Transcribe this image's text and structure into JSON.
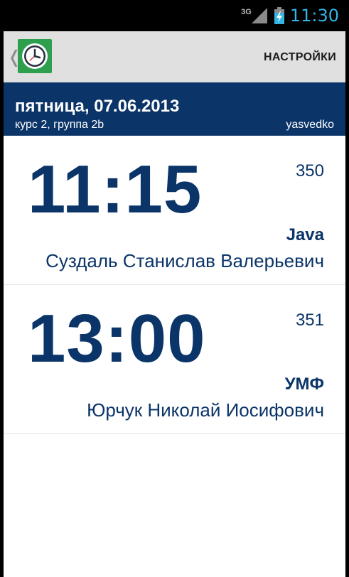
{
  "status_bar": {
    "network": "3G",
    "time": "11:30",
    "time_color": "#33b5e5",
    "icons": [
      "signal-icon",
      "battery-charging-icon"
    ]
  },
  "action_bar": {
    "up_icon": "chevron-left-icon",
    "logo_icon": "clock-icon",
    "logo_color": "#2ea04d",
    "settings_label": "НАСТРОЙКИ"
  },
  "header": {
    "date": "пятница, 07.06.2013",
    "group": "курс 2, группа 2b",
    "user": "yasvedko",
    "background": "#0b3468"
  },
  "lessons": [
    {
      "time": "11:15",
      "room": "350",
      "subject": "Java",
      "teacher": "Суздаль Станислав Валерьевич"
    },
    {
      "time": "13:00",
      "room": "351",
      "subject": "УМФ",
      "teacher": "Юрчук Николай Иосифович"
    }
  ],
  "accent_color": "#0b3468"
}
